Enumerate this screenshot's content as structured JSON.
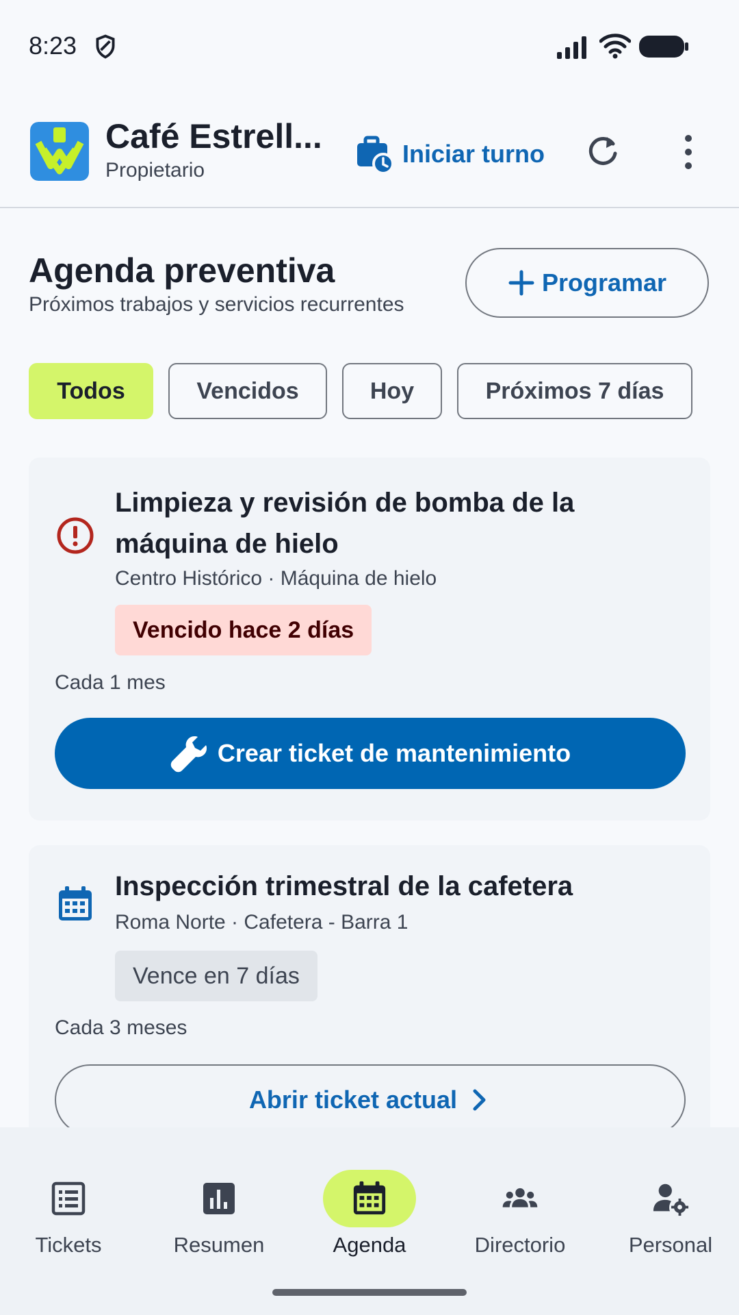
{
  "status_bar": {
    "time": "8:23"
  },
  "header": {
    "business_name": "Café Estrell...",
    "role": "Propietario",
    "shift_label": "Iniciar turno",
    "colors": {
      "accent": "#0f66b3",
      "logo_bg": "#2f8ee0",
      "logo_check": "#c6f02a"
    }
  },
  "section": {
    "title": "Agenda preventiva",
    "subtitle": "Próximos trabajos y servicios recurrentes",
    "schedule_label": "Programar"
  },
  "filters": [
    {
      "label": "Todos",
      "active": true
    },
    {
      "label": "Vencidos",
      "active": false
    },
    {
      "label": "Hoy",
      "active": false
    },
    {
      "label": "Próximos 7 días",
      "active": false
    }
  ],
  "cards": [
    {
      "icon": "alert-circle-icon",
      "title": "Limpieza y revisión de bomba de la máquina de hielo",
      "meta": "Centro Histórico · Máquina de hielo",
      "badge": "Vencido hace 2 días",
      "frequency": "Cada 1 mes",
      "action_label": "Crear ticket de mantenimiento",
      "action_icon": "wrench-icon"
    },
    {
      "icon": "calendar-icon",
      "title": "Inspección trimestral de la cafetera",
      "meta": "Roma Norte · Cafetera - Barra 1",
      "badge": "Vence en 7 días",
      "frequency": "Cada 3 meses",
      "action_label": "Abrir ticket actual",
      "action_icon": "chevron-right-icon"
    }
  ],
  "nav": [
    {
      "label": "Tickets",
      "icon": "list-icon",
      "active": false
    },
    {
      "label": "Resumen",
      "icon": "bar-chart-icon",
      "active": false
    },
    {
      "label": "Agenda",
      "icon": "calendar-icon",
      "active": true
    },
    {
      "label": "Directorio",
      "icon": "group-icon",
      "active": false
    },
    {
      "label": "Personal",
      "icon": "user-settings-icon",
      "active": false
    }
  ],
  "colors": {
    "primary": "#0066b3",
    "active_chip": "#d4f56a",
    "overdue_badge_bg": "#ffd9d6",
    "overdue_icon": "#b3261e",
    "card_bg": "#f1f4f8"
  }
}
